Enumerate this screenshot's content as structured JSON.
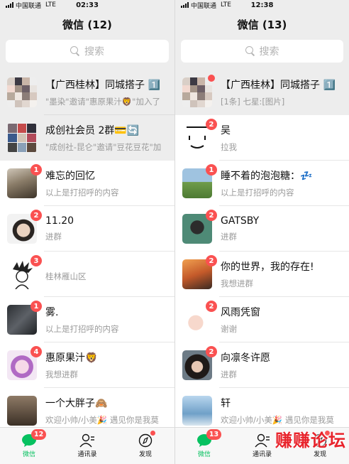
{
  "left": {
    "status": {
      "carrier": "中国联通",
      "network": "LTE",
      "time": "02:33"
    },
    "title": "微信 (12)",
    "search_placeholder": "搜索",
    "chats": [
      {
        "name": "【广西桂林】同城搭子 1️⃣",
        "preview": "\"墨染\"邀请\"惠原果汁🦁\"加入了",
        "pinned": true
      },
      {
        "name": "成创社会员 2群💳🔄",
        "preview": "\"成创社-昆仑\"邀请\"豆花豆花\"加",
        "pinned": true
      },
      {
        "name": "难忘的回忆",
        "preview": "以上是打招呼的内容",
        "badge": "1"
      },
      {
        "name": "11.20",
        "preview": "进群",
        "badge": "2"
      },
      {
        "name": "",
        "preview": "桂林雁山区",
        "badge": "3"
      },
      {
        "name": "雾.",
        "preview": "以上是打招呼的内容",
        "badge": "1"
      },
      {
        "name": "惠原果汁🦁",
        "preview": "我想进群",
        "badge": "4"
      },
      {
        "name": "一个大胖子🙈",
        "preview": "欢迎小帅/小美🎉 遇见你是我莫"
      }
    ],
    "tabs": {
      "chats": "微信",
      "contacts": "通讯录",
      "discover": "发现",
      "chats_badge": "12"
    }
  },
  "right": {
    "status": {
      "carrier": "中国联通",
      "network": "LTE",
      "time": "12:38"
    },
    "title": "微信 (13)",
    "search_placeholder": "搜索",
    "chats": [
      {
        "name": "【广西桂林】同城搭子 1️⃣",
        "preview": "[1条] 七星:[图片]",
        "pinned": true
      },
      {
        "name": "吴",
        "preview": "拉我",
        "badge": "2"
      },
      {
        "name": "睡不着的泡泡糖：💤",
        "preview": "以上是打招呼的内容",
        "badge": "1"
      },
      {
        "name": "GATSBY",
        "preview": "进群",
        "badge": "2"
      },
      {
        "name": "你的世界，我的存在!",
        "preview": "我想进群",
        "badge": "2"
      },
      {
        "name": "风雨凭窗",
        "preview": "谢谢",
        "badge": "2"
      },
      {
        "name": "向凛冬许愿",
        "preview": "进群",
        "badge": "2"
      },
      {
        "name": "轩",
        "preview": "欢迎小帅/小美🎉 遇见你是我莫"
      }
    ],
    "tabs": {
      "chats": "微信",
      "contacts": "通讯录",
      "discover": "发现",
      "chats_badge": "13"
    },
    "watermark": "赚赚论坛"
  },
  "colors": {
    "accent": "#07c160",
    "badge": "#fa5151",
    "pinned_bg": "#ededed"
  },
  "icons": [
    "search-icon",
    "chat-bubble-icon",
    "contacts-icon",
    "compass-icon"
  ]
}
